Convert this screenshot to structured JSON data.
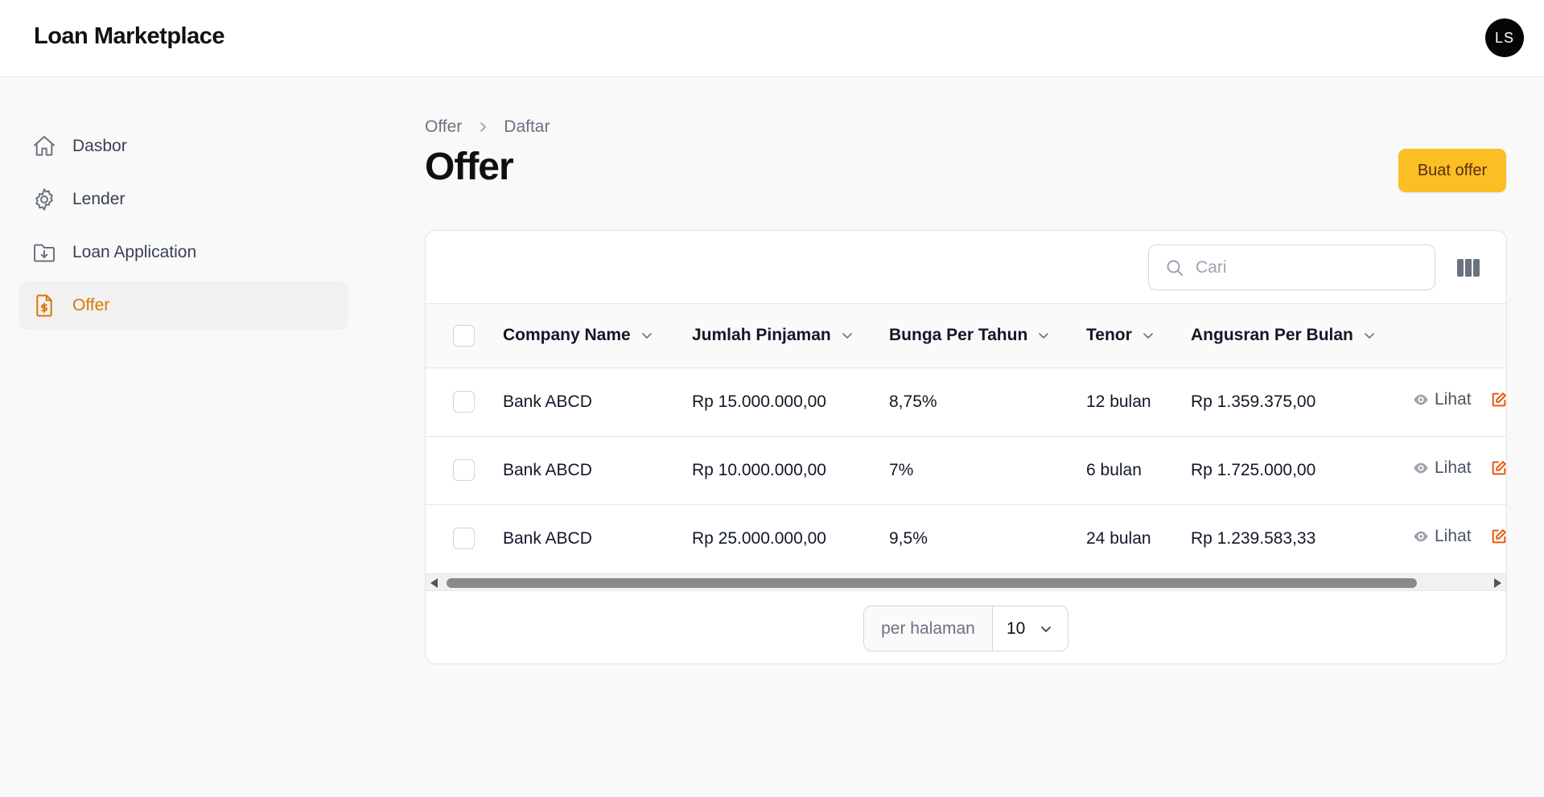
{
  "app": {
    "title": "Loan Marketplace",
    "user_initials": "LS"
  },
  "sidebar": {
    "items": [
      {
        "label": "Dasbor",
        "icon": "home-icon",
        "active": false
      },
      {
        "label": "Lender",
        "icon": "gear-icon",
        "active": false
      },
      {
        "label": "Loan Application",
        "icon": "folder-download-icon",
        "active": false
      },
      {
        "label": "Offer",
        "icon": "document-dollar-icon",
        "active": true
      }
    ]
  },
  "breadcrumb": {
    "items": [
      "Offer",
      "Daftar"
    ]
  },
  "page": {
    "title": "Offer",
    "create_button": "Buat offer"
  },
  "search": {
    "placeholder": "Cari",
    "value": ""
  },
  "table": {
    "columns": [
      "Company Name",
      "Jumlah Pinjaman",
      "Bunga Per Tahun",
      "Tenor",
      "Angusran Per Bulan"
    ],
    "rows": [
      {
        "company": "Bank ABCD",
        "amount": "Rp 15.000.000,00",
        "interest": "8,75%",
        "tenor": "12 bulan",
        "installment": "Rp 1.359.375,00",
        "view_label": "Lihat"
      },
      {
        "company": "Bank ABCD",
        "amount": "Rp 10.000.000,00",
        "interest": "7%",
        "tenor": "6 bulan",
        "installment": "Rp 1.725.000,00",
        "view_label": "Lihat"
      },
      {
        "company": "Bank ABCD",
        "amount": "Rp 25.000.000,00",
        "interest": "9,5%",
        "tenor": "24 bulan",
        "installment": "Rp 1.239.583,33",
        "view_label": "Lihat"
      }
    ]
  },
  "pagination": {
    "per_page_label": "per halaman",
    "per_page_value": "10"
  },
  "colors": {
    "accent": "#fbbf24",
    "active_nav": "#d97706",
    "edit_icon": "#ea580c"
  }
}
